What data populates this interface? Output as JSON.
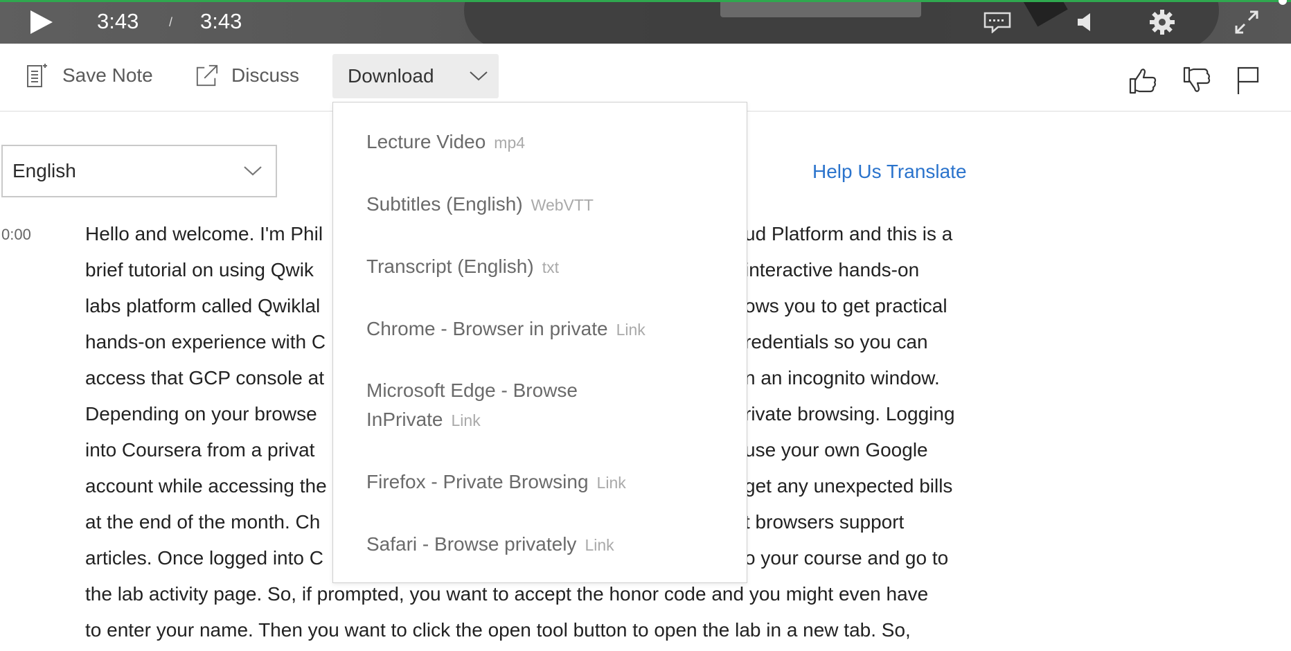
{
  "player": {
    "current_time": "3:43",
    "separator": "/",
    "duration": "3:43",
    "progress_fraction": 1.0,
    "icons": [
      "play-icon",
      "captions-icon",
      "volume-icon",
      "gear-icon",
      "fullscreen-icon"
    ]
  },
  "toolbar": {
    "save_note_label": "Save Note",
    "discuss_label": "Discuss",
    "download_label": "Download",
    "icons": [
      "note-icon",
      "external-link-icon",
      "chevron-down-icon",
      "thumbs-up-icon",
      "thumbs-down-icon",
      "flag-icon"
    ]
  },
  "language": {
    "selected": "English",
    "help_translate": "Help Us Translate"
  },
  "download_menu": {
    "items": [
      {
        "label": "Lecture Video",
        "format": "mp4"
      },
      {
        "label": "Subtitles (English)",
        "format": "WebVTT"
      },
      {
        "label": "Transcript (English)",
        "format": "txt"
      },
      {
        "label": "Chrome - Browser in private",
        "format": "Link"
      },
      {
        "label_line1": "Microsoft Edge - Browse",
        "label_line2": "InPrivate",
        "format": "Link"
      },
      {
        "label": "Firefox - Private Browsing",
        "format": "Link"
      },
      {
        "label": "Safari - Browse privately",
        "format": "Link"
      }
    ]
  },
  "transcript": {
    "timestamp": "0:00",
    "lines": [
      "Hello and welcome. I'm Phil",
      "brief tutorial on using Qwik",
      "labs platform called Qwiklal",
      "hands-on experience with C",
      "access that GCP console at",
      "Depending on your browse",
      "into Coursera from a privat",
      "account while accessing the",
      "at the end of the month. Ch",
      "articles. Once logged into C",
      "the lab activity page. So, if prompted, you want to accept the honor code and you might even have",
      "to enter your name. Then you want to click the open tool button to open the lab in a new tab. So,"
    ],
    "right_fragments": [
      "ud Platform and this is a",
      "interactive hands-on",
      "ows you to get practical",
      "redentials so you can",
      "n an incognito window.",
      "rivate browsing. Logging",
      "use your own Google",
      "get any unexpected bills",
      "t browsers support",
      "o your course and go to"
    ]
  },
  "colors": {
    "accent_link": "#2a73cc",
    "progress": "#2fa84f"
  }
}
